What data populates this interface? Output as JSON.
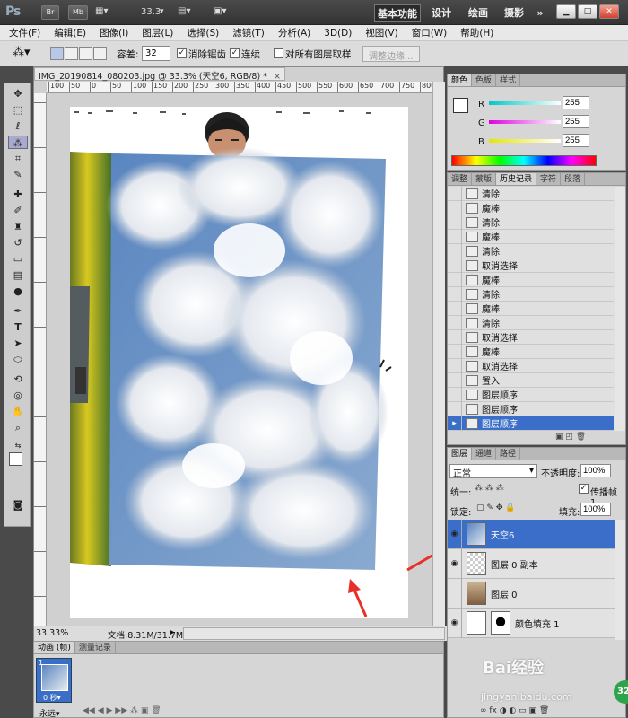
{
  "titlebar": {
    "app_logo": "Ps",
    "br_label": "Br",
    "mb_label": "Mb",
    "zoom": "33.3",
    "workspaces": [
      "基本功能",
      "设计",
      "绘画",
      "摄影"
    ],
    "more": "»"
  },
  "menu": [
    "文件(F)",
    "编辑(E)",
    "图像(I)",
    "图层(L)",
    "选择(S)",
    "滤镜(T)",
    "分析(A)",
    "3D(D)",
    "视图(V)",
    "窗口(W)",
    "帮助(H)"
  ],
  "options": {
    "tolerance_label": "容差:",
    "tolerance_value": "32",
    "antialias_label": "消除锯齿",
    "contiguous_label": "连续",
    "sample_all_label": "对所有图层取样",
    "refine_edge": "调整边缘..."
  },
  "document": {
    "tab_title": "IMG_20190814_080203.jpg @ 33.3% (天空6, RGB/8) *",
    "close": "×",
    "ruler_marks": [
      "100",
      "50",
      "0",
      "50",
      "100",
      "150",
      "200",
      "250",
      "300",
      "350",
      "400",
      "450",
      "500",
      "550",
      "600",
      "650",
      "700",
      "750",
      "800"
    ],
    "zoom_status": "33.33%",
    "doc_status": "文档:8.31M/31.7M"
  },
  "color_panel": {
    "tabs": [
      "颜色",
      "色板",
      "样式"
    ],
    "channels": [
      {
        "label": "R",
        "value": "255",
        "gradient": "#00c8c8"
      },
      {
        "label": "G",
        "value": "255",
        "gradient": "#e000e0"
      },
      {
        "label": "B",
        "value": "255",
        "gradient": "#e6e600"
      }
    ]
  },
  "history_panel": {
    "tabs": [
      "调整",
      "蒙版",
      "历史记录",
      "字符",
      "段落"
    ],
    "items": [
      "清除",
      "魔棒",
      "清除",
      "魔棒",
      "清除",
      "取消选择",
      "魔棒",
      "清除",
      "魔棒",
      "清除",
      "取消选择",
      "魔棒",
      "取消选择",
      "置入",
      "图层顺序",
      "图层顺序",
      "图层顺序"
    ],
    "selected_index": 16
  },
  "layers_panel": {
    "tabs": [
      "图层",
      "通道",
      "路径"
    ],
    "blend_mode": "正常",
    "opacity_label": "不透明度:",
    "opacity_value": "100%",
    "unify_label": "统一:",
    "propagate_label": "传播帧 1",
    "lock_label": "锁定:",
    "fill_label": "填充:",
    "fill_value": "100%",
    "layers": [
      {
        "name": "天空6",
        "visible": true,
        "selected": true
      },
      {
        "name": "图层 0 副本",
        "visible": true,
        "selected": false
      },
      {
        "name": "图层 0",
        "visible": false,
        "selected": false
      },
      {
        "name": "颜色填充 1",
        "visible": true,
        "selected": false
      }
    ]
  },
  "animation_panel": {
    "tabs": [
      "动画 (帧)",
      "测量记录"
    ],
    "frame_number": "1",
    "frame_delay": "0 秒▾",
    "loop": "永远▾"
  },
  "watermark": {
    "line1": "Bai经验",
    "line2": "jingyan.baidu.com",
    "badge": "32"
  },
  "colors": {
    "selection": "#3a6ec8",
    "accent_arrow": "#e8302a"
  }
}
